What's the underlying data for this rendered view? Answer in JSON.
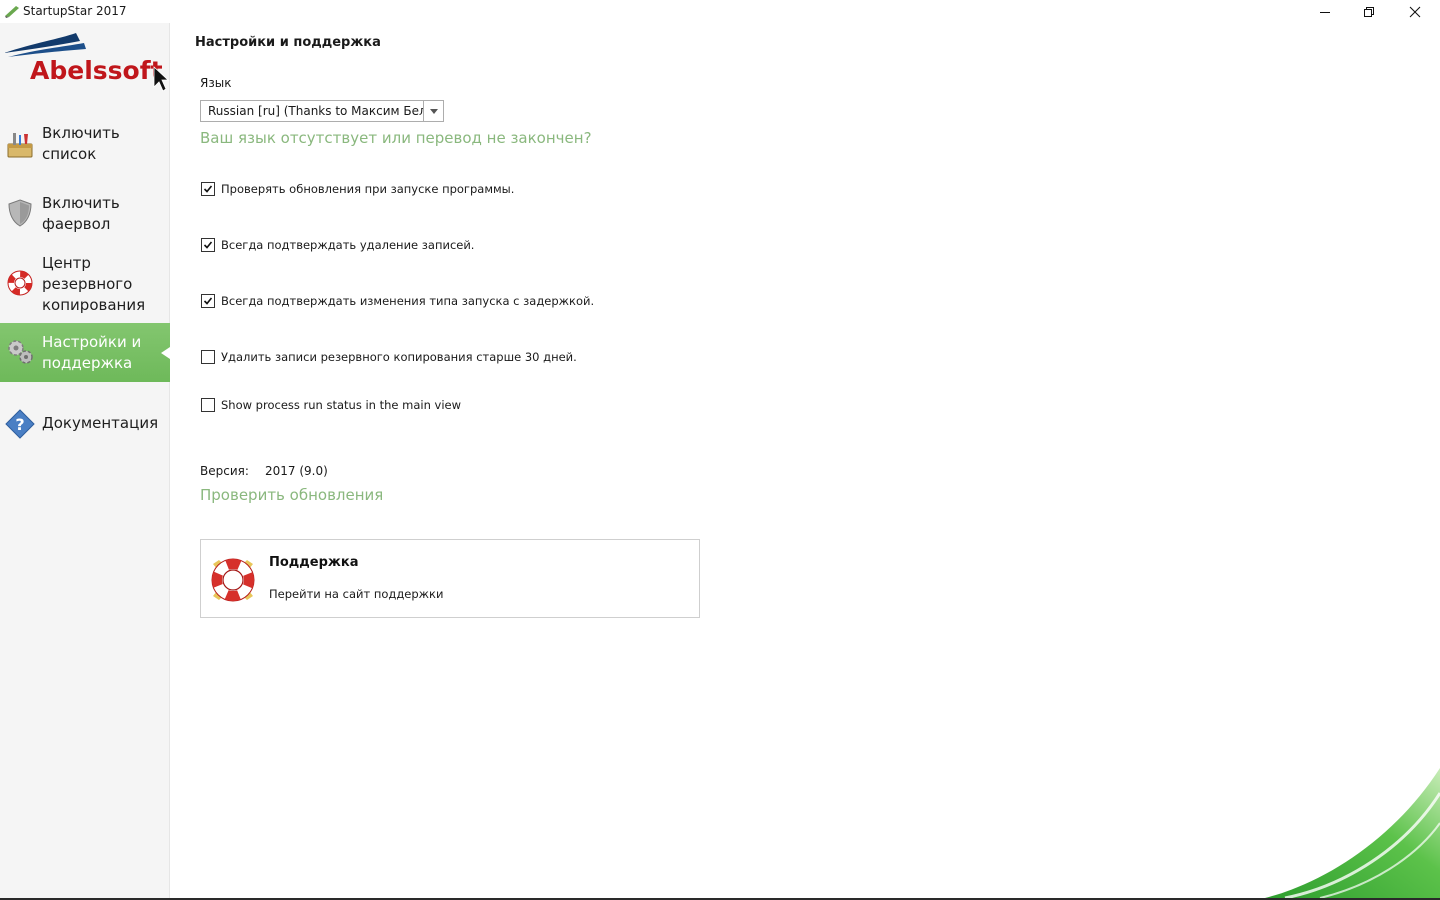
{
  "window": {
    "title": "StartupStar 2017",
    "controls": [
      "minimize-icon",
      "restore-icon",
      "close-icon"
    ]
  },
  "sidebar": {
    "logo_text": "Abelssoft",
    "items": [
      {
        "label": "Включить список",
        "icon": "toolbox-icon",
        "active": false
      },
      {
        "label": "Включить фаервол",
        "icon": "shield-icon",
        "active": false
      },
      {
        "label": "Центр резервного копирования",
        "icon": "lifebuoy-icon",
        "active": false
      },
      {
        "label": "Настройки и поддержка",
        "icon": "gears-icon",
        "active": true
      },
      {
        "label": "Документация",
        "icon": "help-icon",
        "active": false
      }
    ]
  },
  "settings": {
    "title": "Настройки и поддержка",
    "language_label": "Язык",
    "language_value": "Russian [ru]  (Thanks to Максим Белов)",
    "language_link": "Ваш язык отсутствует или перевод не закончен?",
    "options": [
      {
        "label": "Проверять обновления при запуске программы.",
        "checked": true
      },
      {
        "label": "Всегда подтверждать удаление записей.",
        "checked": true
      },
      {
        "label": "Всегда подтверждать изменения типа запуска с задержкой.",
        "checked": true
      },
      {
        "label": "Удалить записи резервного копирования старше 30 дней.",
        "checked": false
      },
      {
        "label": "Show process run status in the main view",
        "checked": false
      }
    ],
    "version_label": "Версия:",
    "version_value": "2017 (9.0)",
    "update_link": "Проверить обновления"
  },
  "support": {
    "title": "Поддержка",
    "subtitle": "Перейти на сайт поддержки"
  },
  "colors": {
    "accent_green": "#6eb95a",
    "link_green": "#8ab87e",
    "sidebar_bg": "#f5f5f5"
  }
}
